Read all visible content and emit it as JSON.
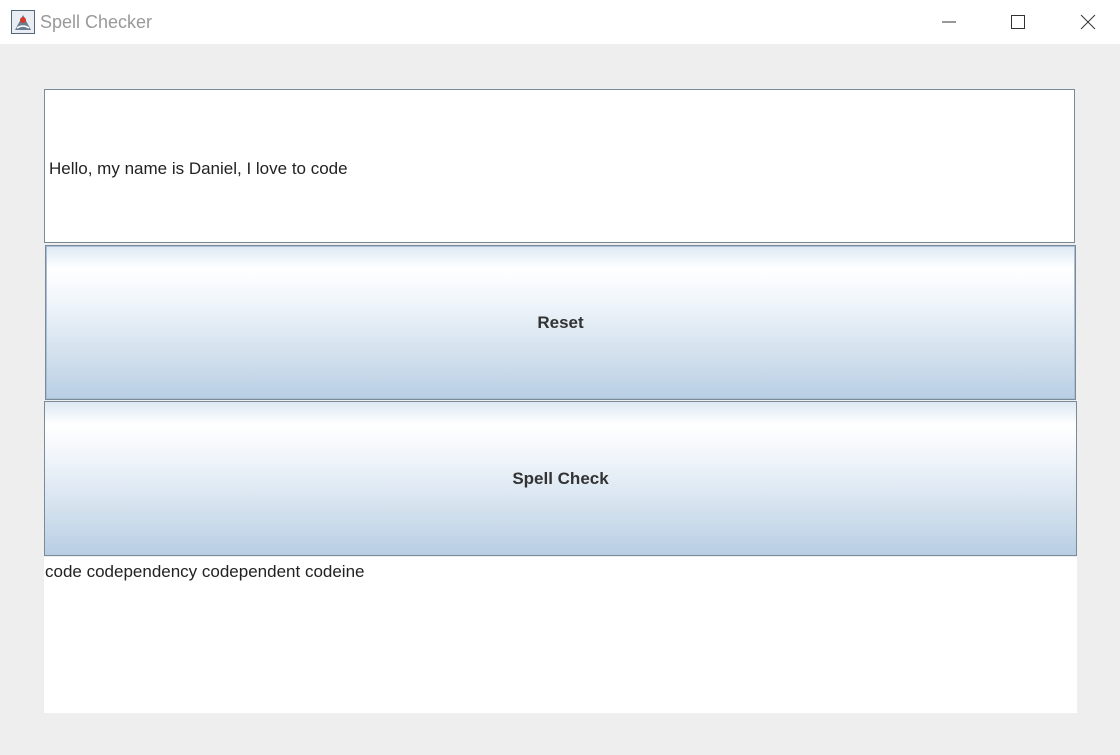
{
  "window": {
    "title": "Spell Checker",
    "controls": {
      "minimize_icon": "minimize-icon",
      "maximize_icon": "maximize-icon",
      "close_icon": "close-icon"
    }
  },
  "form": {
    "input_value": "Hello, my name is Daniel, I love to code",
    "reset_label": "Reset",
    "spell_check_label": "Spell Check",
    "output_text": "code codependency codependent codeine"
  },
  "colors": {
    "button_gradient_top": "#ffffff",
    "button_gradient_bottom": "#b8cee4",
    "border": "#7a8a99",
    "background": "#eeeeee"
  }
}
